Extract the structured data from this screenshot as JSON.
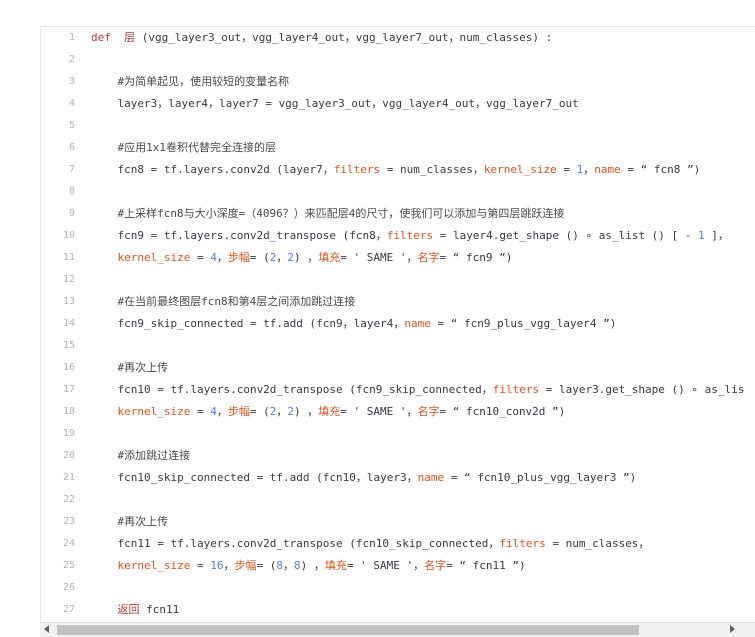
{
  "code": {
    "lines": [
      {
        "n": "1",
        "tokens": [
          {
            "t": "def",
            "c": "kw"
          },
          {
            "t": "  ",
            "c": "plain"
          },
          {
            "t": "层",
            "c": "kw"
          },
          {
            "t": " (vgg_layer3_out，vgg_layer4_out，vgg_layer7_out，num_classes) :",
            "c": "plain"
          }
        ]
      },
      {
        "n": "2",
        "tokens": []
      },
      {
        "n": "3",
        "tokens": [
          {
            "t": "    #为简单起见，使用较短的变量名称",
            "c": "cm"
          }
        ]
      },
      {
        "n": "4",
        "tokens": [
          {
            "t": "    layer3，layer4，layer7 = vgg_layer3_out，vgg_layer4_out，vgg_layer7_out",
            "c": "plain"
          }
        ]
      },
      {
        "n": "5",
        "tokens": []
      },
      {
        "n": "6",
        "tokens": [
          {
            "t": "    #应用1x1卷积代替完全连接的层",
            "c": "cm"
          }
        ]
      },
      {
        "n": "7",
        "tokens": [
          {
            "t": "    fcn8 = tf.layers.conv2d (layer7，",
            "c": "plain"
          },
          {
            "t": "filters",
            "c": "param"
          },
          {
            "t": " = num_classes，",
            "c": "plain"
          },
          {
            "t": "kernel_size",
            "c": "param"
          },
          {
            "t": " = ",
            "c": "plain"
          },
          {
            "t": "1",
            "c": "num"
          },
          {
            "t": "，",
            "c": "plain"
          },
          {
            "t": "name",
            "c": "param"
          },
          {
            "t": " = “ fcn8 ”)",
            "c": "str"
          }
        ]
      },
      {
        "n": "8",
        "tokens": []
      },
      {
        "n": "9",
        "tokens": [
          {
            "t": "    #上采样fcn8与大小深度=（4096？）来匹配层4的尺寸，使我们可以添加与第四层跳跃连接",
            "c": "cm"
          }
        ]
      },
      {
        "n": "10",
        "tokens": [
          {
            "t": "    fcn9 = tf.layers.conv2d_transpose (fcn8，",
            "c": "plain"
          },
          {
            "t": "filters",
            "c": "param"
          },
          {
            "t": " = layer4.get_shape () ∘ as_list () [ - ",
            "c": "plain"
          },
          {
            "t": "1",
            "c": "num"
          },
          {
            "t": " ]，",
            "c": "plain"
          }
        ]
      },
      {
        "n": "11",
        "tokens": [
          {
            "t": "    ",
            "c": "plain"
          },
          {
            "t": "kernel_size",
            "c": "param"
          },
          {
            "t": " = ",
            "c": "plain"
          },
          {
            "t": "4",
            "c": "num"
          },
          {
            "t": "，",
            "c": "plain"
          },
          {
            "t": "步幅",
            "c": "param"
          },
          {
            "t": "= (",
            "c": "plain"
          },
          {
            "t": "2",
            "c": "num"
          },
          {
            "t": "，",
            "c": "plain"
          },
          {
            "t": "2",
            "c": "num"
          },
          {
            "t": ") ，",
            "c": "plain"
          },
          {
            "t": "填充",
            "c": "param"
          },
          {
            "t": "= ' SAME '，",
            "c": "plain"
          },
          {
            "t": "名字",
            "c": "param"
          },
          {
            "t": "= “ fcn9 ”)",
            "c": "plain"
          }
        ]
      },
      {
        "n": "12",
        "tokens": []
      },
      {
        "n": "13",
        "tokens": [
          {
            "t": "    #在当前最终图层fcn8和第4层之间添加跳过连接",
            "c": "cm"
          }
        ]
      },
      {
        "n": "14",
        "tokens": [
          {
            "t": "    fcn9_skip_connected = tf.add (fcn9，layer4，",
            "c": "plain"
          },
          {
            "t": "name",
            "c": "param"
          },
          {
            "t": " = “ fcn9_plus_vgg_layer4 ”)",
            "c": "plain"
          }
        ]
      },
      {
        "n": "15",
        "tokens": []
      },
      {
        "n": "16",
        "tokens": [
          {
            "t": "    #再次上传",
            "c": "cm"
          }
        ]
      },
      {
        "n": "17",
        "tokens": [
          {
            "t": "    fcn10 = tf.layers.conv2d_transpose (fcn9_skip_connected，",
            "c": "plain"
          },
          {
            "t": "filters",
            "c": "param"
          },
          {
            "t": " = layer3.get_shape () ∘ as_lis",
            "c": "plain"
          }
        ]
      },
      {
        "n": "18",
        "tokens": [
          {
            "t": "    ",
            "c": "plain"
          },
          {
            "t": "kernel_size",
            "c": "param"
          },
          {
            "t": " = ",
            "c": "plain"
          },
          {
            "t": "4",
            "c": "num"
          },
          {
            "t": "，",
            "c": "plain"
          },
          {
            "t": "步幅",
            "c": "param"
          },
          {
            "t": "= (",
            "c": "plain"
          },
          {
            "t": "2",
            "c": "num"
          },
          {
            "t": "，",
            "c": "plain"
          },
          {
            "t": "2",
            "c": "num"
          },
          {
            "t": ") ，",
            "c": "plain"
          },
          {
            "t": "填充",
            "c": "param"
          },
          {
            "t": "= ' SAME '，",
            "c": "plain"
          },
          {
            "t": "名字",
            "c": "param"
          },
          {
            "t": "= “ fcn10_conv2d ”)",
            "c": "plain"
          }
        ]
      },
      {
        "n": "19",
        "tokens": []
      },
      {
        "n": "20",
        "tokens": [
          {
            "t": "    #添加跳过连接",
            "c": "cm"
          }
        ]
      },
      {
        "n": "21",
        "tokens": [
          {
            "t": "    fcn10_skip_connected = tf.add (fcn10，layer3，",
            "c": "plain"
          },
          {
            "t": "name",
            "c": "param"
          },
          {
            "t": " = “ fcn10_plus_vgg_layer3 ”)",
            "c": "plain"
          }
        ]
      },
      {
        "n": "22",
        "tokens": []
      },
      {
        "n": "23",
        "tokens": [
          {
            "t": "    #再次上传",
            "c": "cm"
          }
        ]
      },
      {
        "n": "24",
        "tokens": [
          {
            "t": "    fcn11 = tf.layers.conv2d_transpose (fcn10_skip_connected，",
            "c": "plain"
          },
          {
            "t": "filters",
            "c": "param"
          },
          {
            "t": " = num_classes，",
            "c": "plain"
          }
        ]
      },
      {
        "n": "25",
        "tokens": [
          {
            "t": "    ",
            "c": "plain"
          },
          {
            "t": "kernel_size",
            "c": "param"
          },
          {
            "t": " = ",
            "c": "plain"
          },
          {
            "t": "16",
            "c": "num"
          },
          {
            "t": "，",
            "c": "plain"
          },
          {
            "t": "步幅",
            "c": "param"
          },
          {
            "t": "= (",
            "c": "plain"
          },
          {
            "t": "8",
            "c": "num"
          },
          {
            "t": "，",
            "c": "plain"
          },
          {
            "t": "8",
            "c": "num"
          },
          {
            "t": ") ，",
            "c": "plain"
          },
          {
            "t": "填充",
            "c": "param"
          },
          {
            "t": "= ' SAME '，",
            "c": "plain"
          },
          {
            "t": "名字",
            "c": "param"
          },
          {
            "t": "= “ fcn11 ”)",
            "c": "plain"
          }
        ]
      },
      {
        "n": "26",
        "tokens": []
      },
      {
        "n": "27",
        "tokens": [
          {
            "t": "    ",
            "c": "plain"
          },
          {
            "t": "返回",
            "c": "kw"
          },
          {
            "t": " fcn11",
            "c": "plain"
          }
        ]
      }
    ]
  },
  "scrollbar": {
    "left_arrow_icon": "chevron-left-icon",
    "right_arrow_icon": "chevron-right-icon"
  },
  "colors": {
    "keyword": "#b33c3c",
    "param": "#d9531e",
    "number": "#4e7fd9",
    "plain": "#383a42",
    "gutter": "#b3b3b3"
  }
}
